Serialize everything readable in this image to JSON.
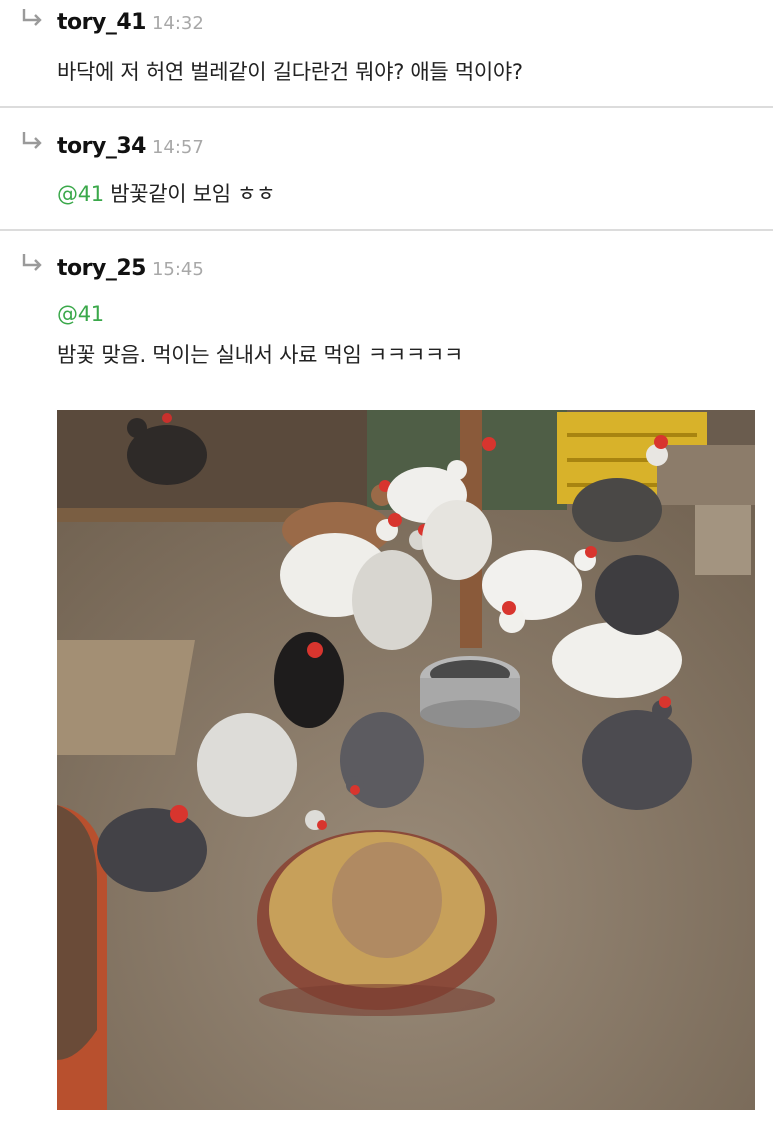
{
  "comments": [
    {
      "username": "tory_41",
      "time": "14:32",
      "mention": "",
      "text": "바닥에 저 허연 벌레같이 길다란건 뭐야? 애들 먹이야?"
    },
    {
      "username": "tory_34",
      "time": "14:57",
      "mention": "@41",
      "text": "밤꽃같이 보임 ㅎㅎ"
    },
    {
      "username": "tory_25",
      "time": "15:45",
      "mention": "@41",
      "text": "밤꽃 맞음. 먹이는 실내서 사료 먹임 ㅋㅋㅋㅋㅋ"
    }
  ],
  "colors": {
    "mention": "#3aa84a",
    "username": "#111111",
    "timestamp": "#a8a8a8",
    "separator": "#dcdcdc",
    "reply_icon": "#9a9a9a"
  },
  "icons": {
    "reply": "reply-arrow-icon"
  }
}
